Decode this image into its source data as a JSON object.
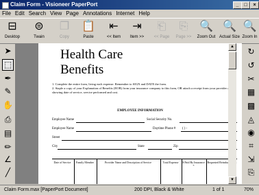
{
  "window": {
    "title": "Claim Form - Visioneer PaperPort",
    "minimize": "_",
    "maximize": "□",
    "close": "×"
  },
  "menu": [
    "File",
    "Edit",
    "Search",
    "View",
    "Page",
    "Annotations",
    "Internet",
    "Help"
  ],
  "toolbar": {
    "desktop": "Desktop",
    "twain": "Twain",
    "copy": "Copy",
    "paste": "Paste",
    "prev_item": "<< Item",
    "next_item": "Item >>",
    "prev_page": "<< Page",
    "next_page": "Page >>",
    "zoom_out": "Zoom Out",
    "actual_size": "Actual Size",
    "zoom_in": "Zoom In"
  },
  "document": {
    "heading_line1": "Health Care",
    "heading_line2": "Benefits",
    "instruction1": "1.  Complete the entire form, living each expense. Remember to SIGN and DATE the form.",
    "instruction2": "2.  Staple a copy of your Explanation of Benefits (EOB) from your insurance company to this form, OR attach a receipt from your provider and showing date of service, service performed and cost.",
    "section_title": "EMPLOYEE INFORMATION",
    "employee_name": "Employee Name",
    "social_security": "Social Security No.",
    "employee_name2": "Employee Name",
    "daytime_phone": "Daytime Phone #",
    "phone_value": "(        )        -",
    "street": "Street",
    "city": "City",
    "state": "State",
    "zip": "Zip",
    "table_headers": [
      "Date of Service",
      "Family Member",
      "Provider Name and Description of Service",
      "Total Expense",
      "$ Paid By Insurance *",
      "Requested Reimbursement"
    ]
  },
  "status": {
    "filename": "Claim Form.max [PaperPort Document]",
    "resolution": "200 DPI, Black & White",
    "page": "1 of 1",
    "zoom": "70%"
  }
}
